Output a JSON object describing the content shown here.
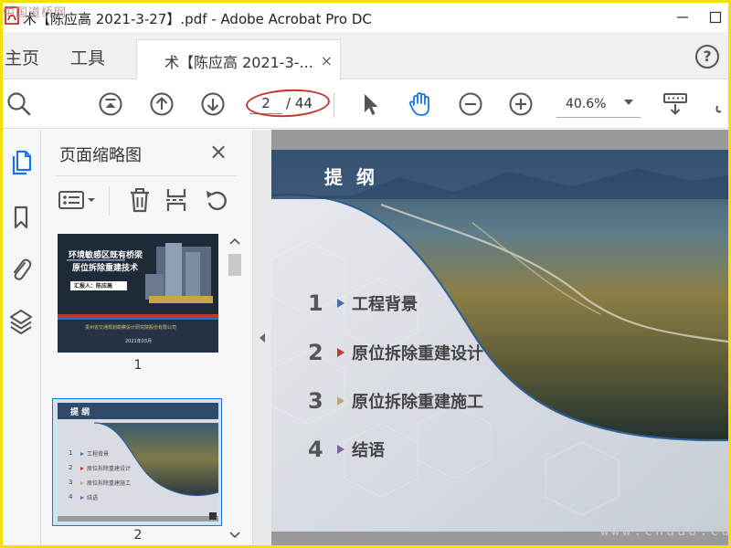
{
  "window": {
    "title": "术【陈应高 2021-3-27】.pdf - Adobe Acrobat Pro DC"
  },
  "watermarks": {
    "top_left": "中国道桥网",
    "bottom_right": "www.cndao.com"
  },
  "tabs": {
    "home": "主页",
    "tools": "工具",
    "document": "术【陈应高 2021-3-...",
    "close_glyph": "×",
    "help_glyph": "?"
  },
  "toolbar": {
    "current_page": "2",
    "page_total": "/ 44",
    "zoom": "40.6%",
    "highlight_color": "#c0392b"
  },
  "thumbnail_panel": {
    "title": "页面缩略图",
    "close_glyph": "×",
    "thumbnails": [
      {
        "number": "1",
        "title_line1": "环境敏感区既有桥梁",
        "title_line2": "原位拆除重建技术",
        "presenter": "汇报人：陈应高",
        "company": "贵州省交通规划勘察设计研究院股份有限公司",
        "date": "2021年03月"
      },
      {
        "number": "2",
        "title": "提 纲",
        "items": [
          "1",
          "工程背景",
          "2",
          "原位拆除重建设计",
          "3",
          "原位拆除重建施工",
          "4",
          "结语"
        ]
      }
    ]
  },
  "slide": {
    "title": "提 纲",
    "items": [
      {
        "num": "1",
        "text": "工程背景",
        "marker": "#3f6fb6"
      },
      {
        "num": "2",
        "text": "原位拆除重建设计",
        "marker": "#c0392b"
      },
      {
        "num": "3",
        "text": "原位拆除重建施工",
        "marker": "#b8a97a"
      },
      {
        "num": "4",
        "text": "结语",
        "marker": "#7a62a8"
      }
    ]
  },
  "colors": {
    "accent_blue": "#1a73e8",
    "slide_header": "#2f4a6b"
  }
}
